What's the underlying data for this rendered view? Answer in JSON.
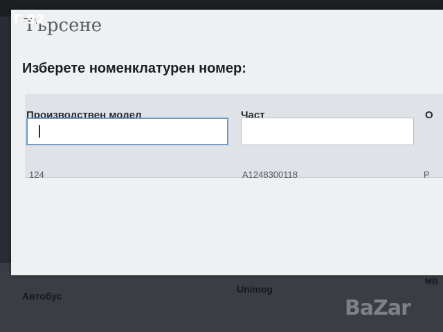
{
  "overlay": {
    "label": "Г-92"
  },
  "dialog": {
    "title": "Търсене",
    "prompt": "Изберете номенклатурен номер:"
  },
  "table": {
    "columns": [
      {
        "header": "Производствен модел",
        "input_value": ""
      },
      {
        "header": "Част",
        "input_value": ""
      },
      {
        "header": "О"
      }
    ],
    "rows": [
      {
        "model": "124",
        "part": "A1248300118",
        "third": "Р"
      }
    ]
  },
  "underlying_page": {
    "items": [
      "Автобус",
      "Unimog",
      "МВ"
    ]
  },
  "watermark": {
    "text": "BaZar"
  }
}
